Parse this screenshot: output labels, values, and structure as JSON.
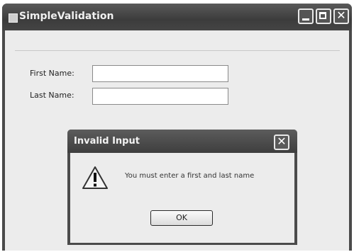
{
  "window": {
    "title": "SimpleValidation"
  },
  "form": {
    "first_name_label": "First Name:",
    "last_name_label": "Last Name:",
    "first_name_value": "",
    "last_name_value": ""
  },
  "dialog": {
    "title": "Invalid Input",
    "message": "You must enter a first and last name",
    "ok_label": "OK",
    "icon": "warning-icon"
  }
}
